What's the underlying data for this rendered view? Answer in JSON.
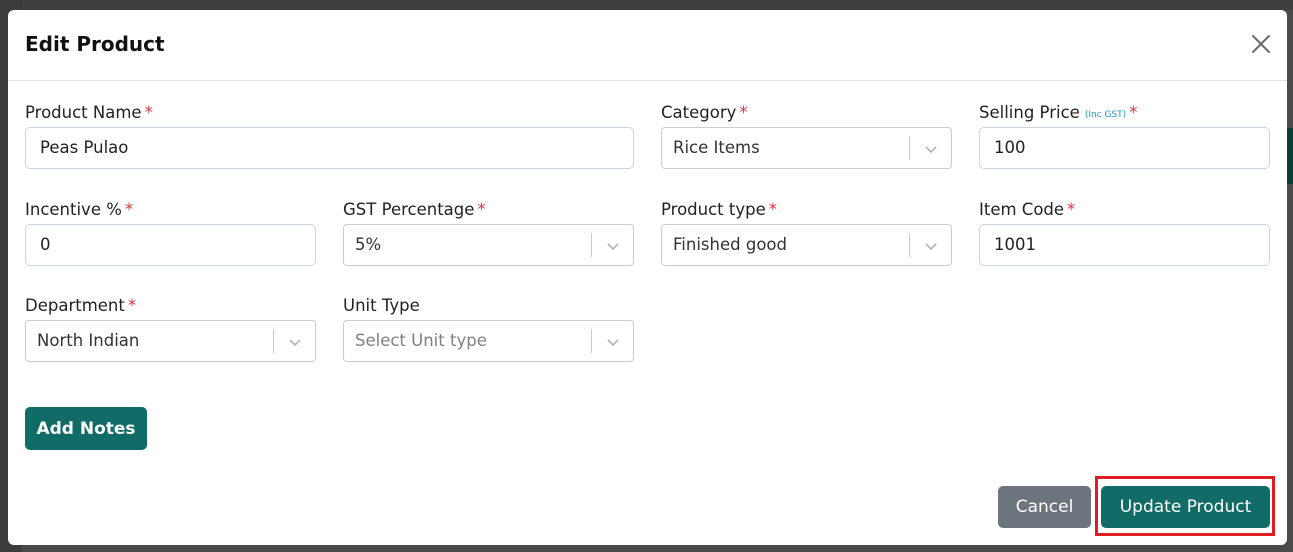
{
  "modal": {
    "title": "Edit Product",
    "close_icon": "close-x-icon"
  },
  "fields": {
    "product_name": {
      "label": "Product Name",
      "required": "*",
      "value": "Peas Pulao"
    },
    "category": {
      "label": "Category",
      "required": "*",
      "value": "Rice Items"
    },
    "selling_price": {
      "label": "Selling Price",
      "hint": "(Inc GST)",
      "required": "*",
      "value": "100"
    },
    "incentive": {
      "label": "Incentive %",
      "required": "*",
      "value": "0"
    },
    "gst_percentage": {
      "label": "GST Percentage",
      "required": "*",
      "value": "5%"
    },
    "product_type": {
      "label": "Product type",
      "required": "*",
      "value": "Finished good"
    },
    "item_code": {
      "label": "Item Code",
      "required": "*",
      "value": "1001"
    },
    "department": {
      "label": "Department",
      "required": "*",
      "value": "North Indian"
    },
    "unit_type": {
      "label": "Unit Type",
      "placeholder": "Select Unit type"
    }
  },
  "buttons": {
    "add_notes": "Add Notes",
    "cancel": "Cancel",
    "update_product": "Update Product"
  },
  "colors": {
    "primary": "#116b66",
    "secondary": "#6c757d",
    "required": "#dc3545",
    "hint": "#1f9bb3",
    "highlight": "#e11d24"
  }
}
